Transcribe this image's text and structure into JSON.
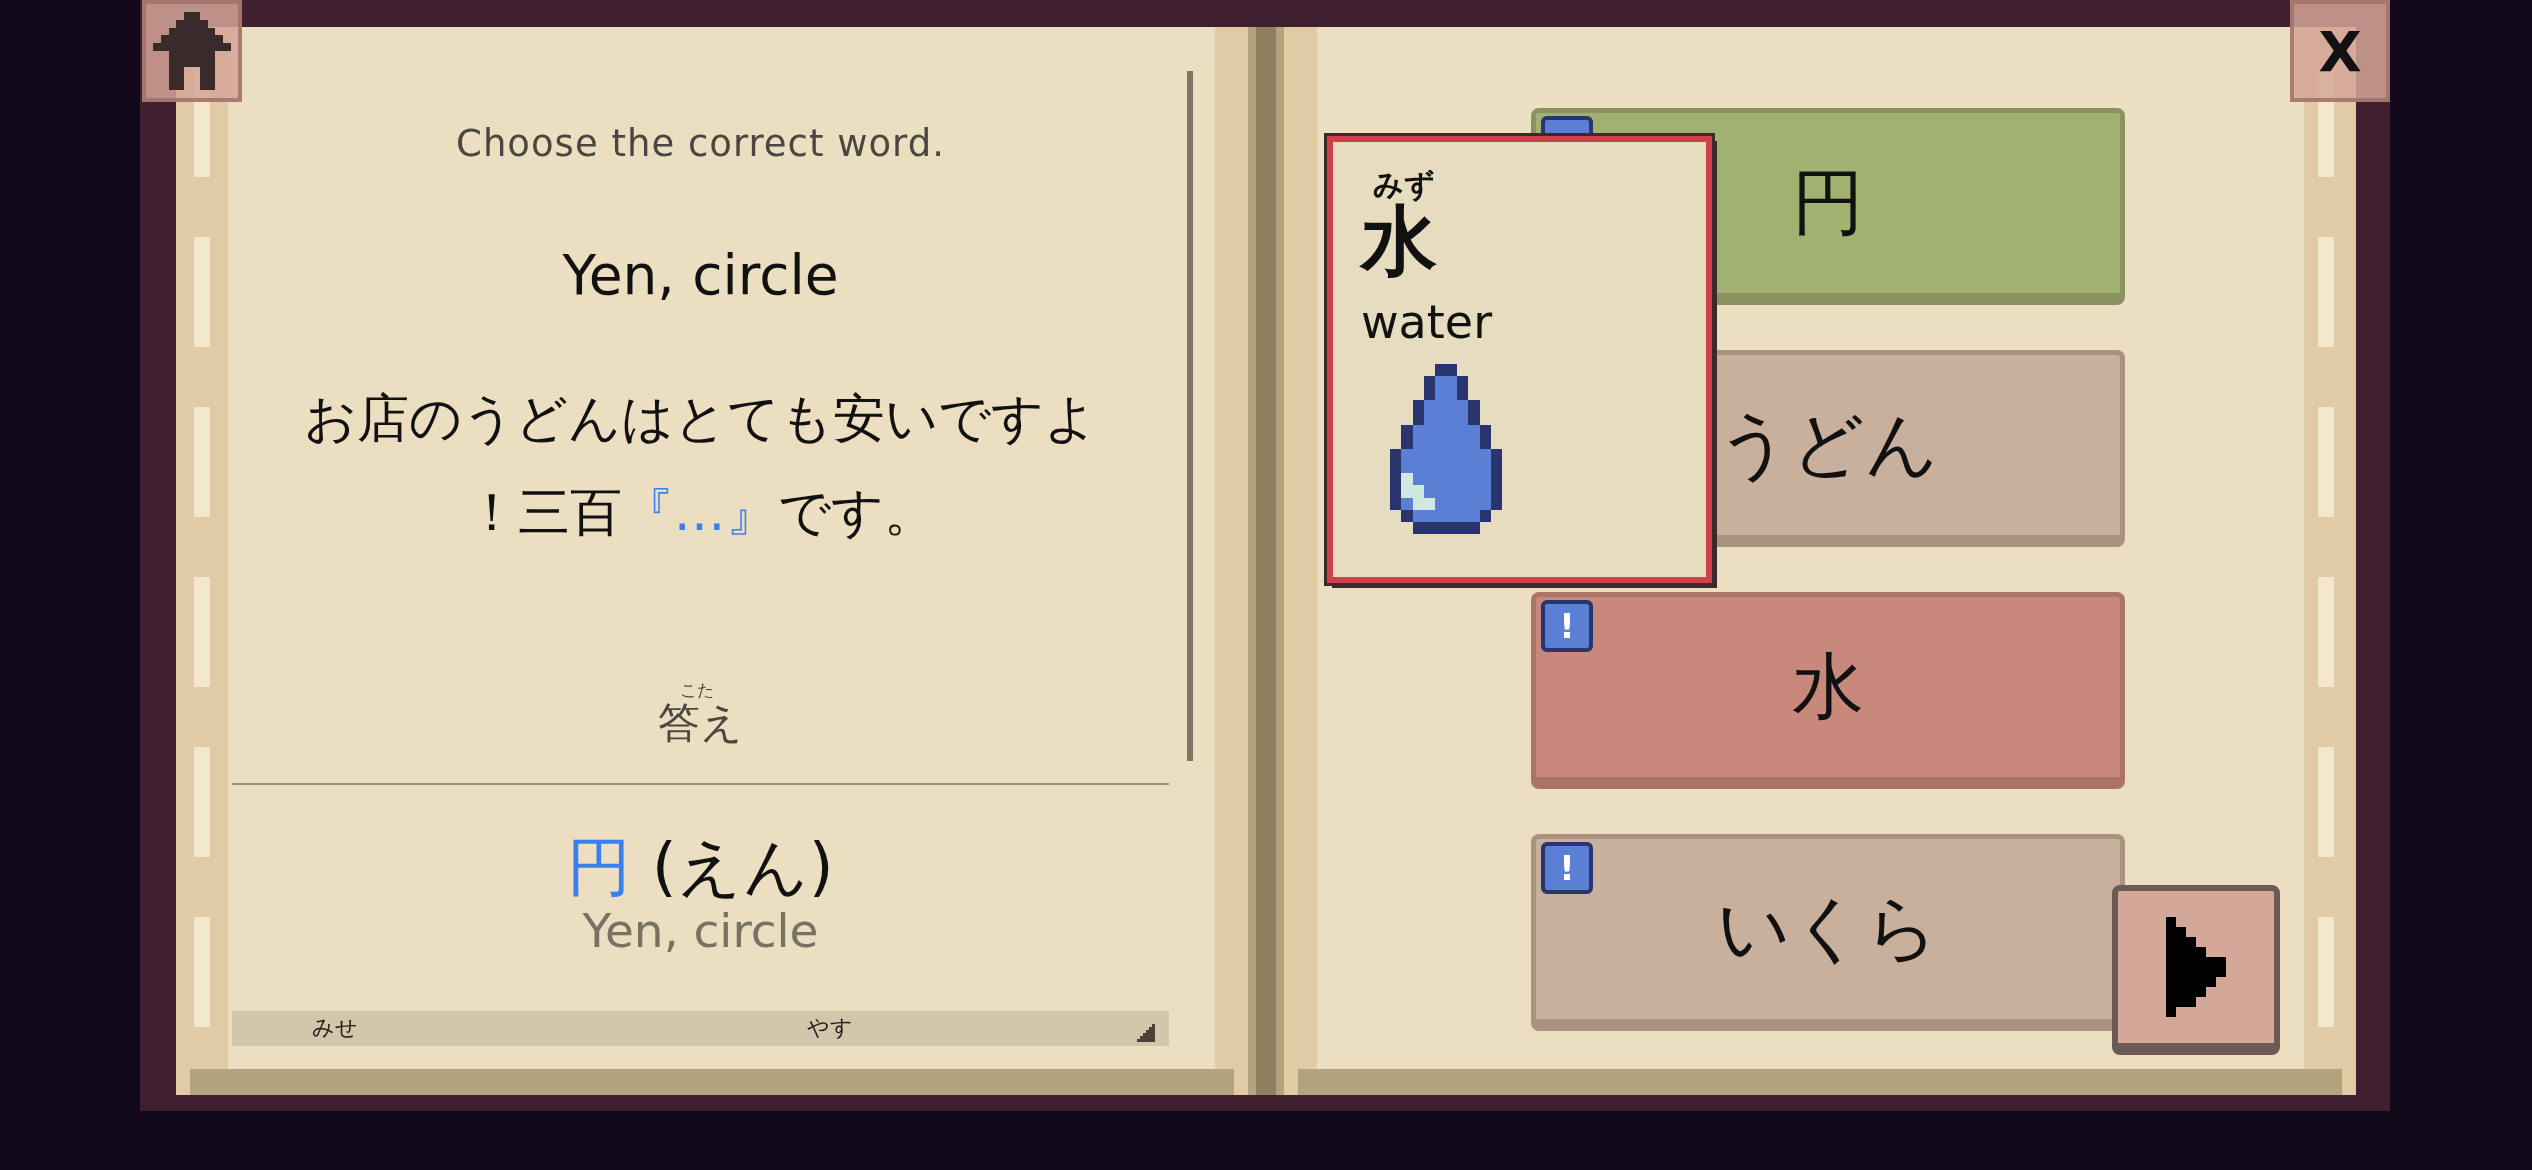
{
  "close_button": {
    "label": "X"
  },
  "prompt": {
    "instruction": "Choose the correct word.",
    "meaning": "Yen, circle",
    "sentence": [
      {
        "text": "お店のうどんはとても安いですよ！三百",
        "blank": false
      },
      {
        "text": "『…』",
        "blank": true
      },
      {
        "text": "です。",
        "blank": false
      }
    ]
  },
  "answer_heading": {
    "furigana": "こた",
    "label": "答え"
  },
  "answer": {
    "word": "円",
    "reading": "(えん)",
    "meaning": "Yen, circle"
  },
  "next_line_furigana": [
    "みせ",
    "やす"
  ],
  "choices": [
    {
      "label": "円",
      "color": "#a1b172",
      "flagged": true
    },
    {
      "label": "うどん",
      "color": "#c9b09d",
      "flagged": false
    },
    {
      "label": "水",
      "color": "#c8897c",
      "flagged": true,
      "badge": "!"
    },
    {
      "label": "いくら",
      "color": "#c9b09d",
      "flagged": true,
      "badge": "!"
    }
  ],
  "word_card": {
    "furigana": "みず",
    "word": "水",
    "meaning": "water"
  }
}
